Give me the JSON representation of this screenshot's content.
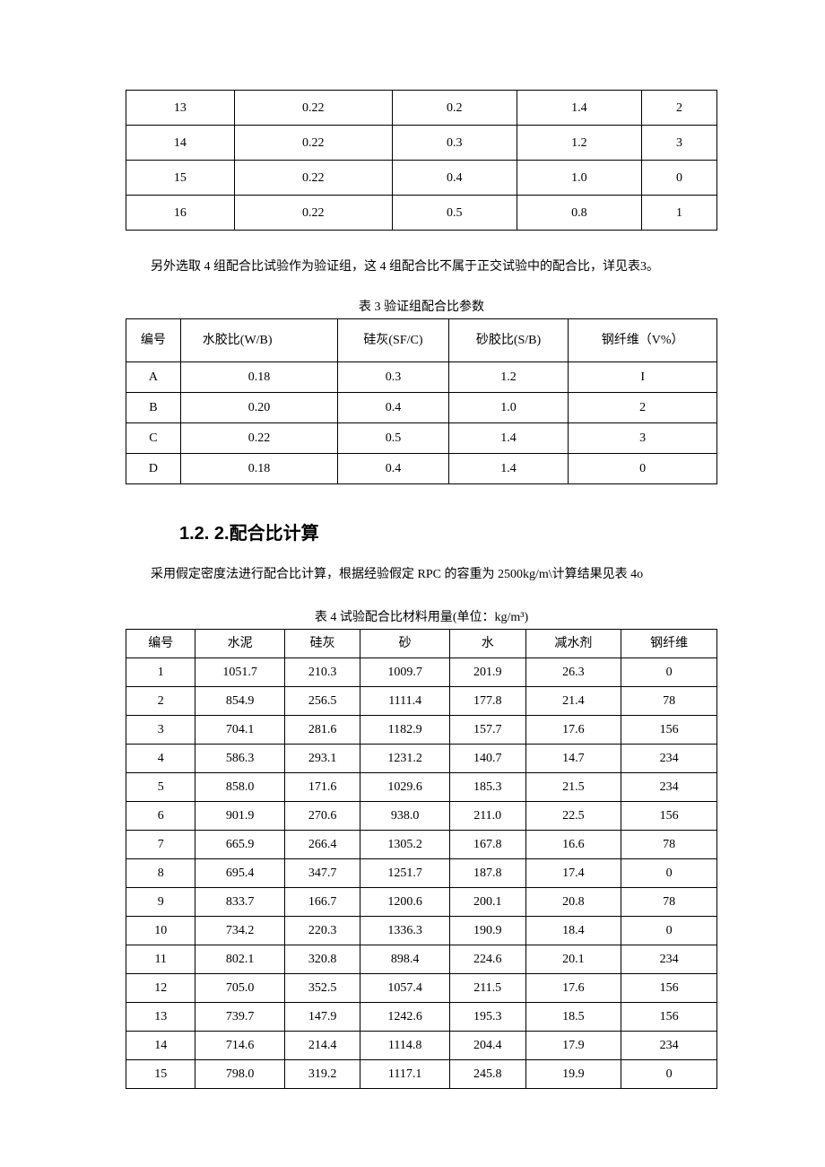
{
  "table1": {
    "rows": [
      [
        "13",
        "0.22",
        "0.2",
        "1.4",
        "2"
      ],
      [
        "14",
        "0.22",
        "0.3",
        "1.2",
        "3"
      ],
      [
        "15",
        "0.22",
        "0.4",
        "1.0",
        "0"
      ],
      [
        "16",
        "0.22",
        "0.5",
        "0.8",
        "1"
      ]
    ]
  },
  "paragraph1": "另外选取 4 组配合比试验作为验证组，这 4 组配合比不属于正交试验中的配合比，详见表3。",
  "table3": {
    "caption": "表 3 验证组配合比参数",
    "headers": [
      "编号",
      "水胶比(W/B)",
      "硅灰(SF/C)",
      "砂胶比(S/B)",
      "钢纤维（V%）"
    ],
    "rows": [
      [
        "A",
        "0.18",
        "0.3",
        "1.2",
        "I"
      ],
      [
        "B",
        "0.20",
        "0.4",
        "1.0",
        "2"
      ],
      [
        "C",
        "0.22",
        "0.5",
        "1.4",
        "3"
      ],
      [
        "D",
        "0.18",
        "0.4",
        "1.4",
        "0"
      ]
    ]
  },
  "heading": "1.2.  2.配合比计算",
  "paragraph2": "采用假定密度法进行配合比计算，根据经验假定 RPC 的容重为 2500kg/m\\计算结果见表 4o",
  "table4": {
    "caption": "表 4 试验配合比材料用量(单位：kg/m³)",
    "headers": [
      "编号",
      "水泥",
      "硅灰",
      "砂",
      "水",
      "减水剂",
      "钢纤维"
    ],
    "rows": [
      [
        "1",
        "1051.7",
        "210.3",
        "1009.7",
        "201.9",
        "26.3",
        "0"
      ],
      [
        "2",
        "854.9",
        "256.5",
        "1111.4",
        "177.8",
        "21.4",
        "78"
      ],
      [
        "3",
        "704.1",
        "281.6",
        "1182.9",
        "157.7",
        "17.6",
        "156"
      ],
      [
        "4",
        "586.3",
        "293.1",
        "1231.2",
        "140.7",
        "14.7",
        "234"
      ],
      [
        "5",
        "858.0",
        "171.6",
        "1029.6",
        "185.3",
        "21.5",
        "234"
      ],
      [
        "6",
        "901.9",
        "270.6",
        "938.0",
        "211.0",
        "22.5",
        "156"
      ],
      [
        "7",
        "665.9",
        "266.4",
        "1305.2",
        "167.8",
        "16.6",
        "78"
      ],
      [
        "8",
        "695.4",
        "347.7",
        "1251.7",
        "187.8",
        "17.4",
        "0"
      ],
      [
        "9",
        "833.7",
        "166.7",
        "1200.6",
        "200.1",
        "20.8",
        "78"
      ],
      [
        "10",
        "734.2",
        "220.3",
        "1336.3",
        "190.9",
        "18.4",
        "0"
      ],
      [
        "11",
        "802.1",
        "320.8",
        "898.4",
        "224.6",
        "20.1",
        "234"
      ],
      [
        "12",
        "705.0",
        "352.5",
        "1057.4",
        "211.5",
        "17.6",
        "156"
      ],
      [
        "13",
        "739.7",
        "147.9",
        "1242.6",
        "195.3",
        "18.5",
        "156"
      ],
      [
        "14",
        "714.6",
        "214.4",
        "1114.8",
        "204.4",
        "17.9",
        "234"
      ],
      [
        "15",
        "798.0",
        "319.2",
        "1117.1",
        "245.8",
        "19.9",
        "0"
      ]
    ]
  }
}
